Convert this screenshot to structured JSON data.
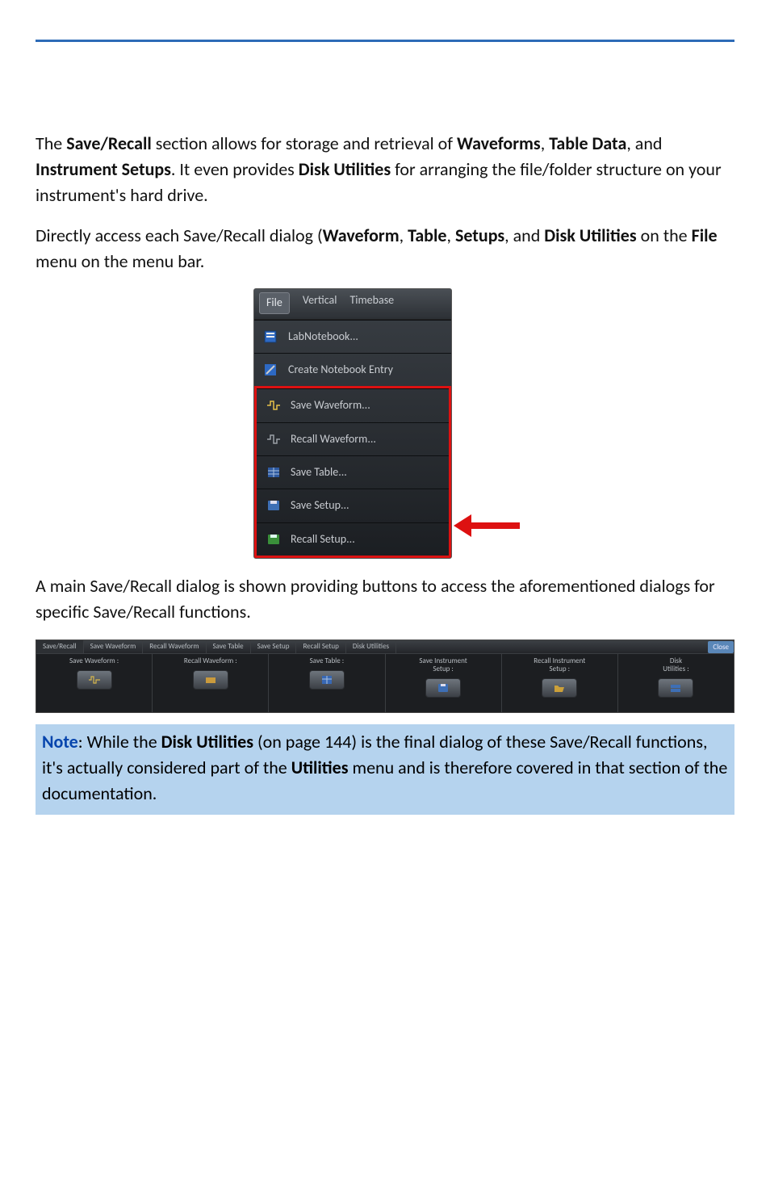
{
  "para1": {
    "t1": "The ",
    "b1": "Save/Recall",
    "t2": " section allows for storage and retrieval of ",
    "b2": "Waveforms",
    "t3": ", ",
    "b3": "Table Data",
    "t4": ", and ",
    "b4": "Instrument Setups",
    "t5": ". It even provides ",
    "b5": "Disk Utilities",
    "t6": " for arranging the file/folder structure on your instrument's hard drive."
  },
  "para2": {
    "t1": "Directly access each Save/Recall dialog (",
    "b1": "Waveform",
    "t2": ", ",
    "b2": "Table",
    "t3": ", ",
    "b3": "Setups",
    "t4": ", and ",
    "b4": "Disk Utilities",
    "t5": " on the ",
    "b5": "File",
    "t6": " menu on the menu bar."
  },
  "menu": {
    "menubar": {
      "file": "File",
      "vertical": "Vertical",
      "timebase": "Timebase"
    },
    "items": {
      "labnotebook": "LabNotebook...",
      "create_entry": "Create Notebook Entry",
      "save_waveform": "Save Waveform...",
      "recall_waveform": "Recall Waveform...",
      "save_table": "Save Table...",
      "save_setup": "Save Setup...",
      "recall_setup": "Recall Setup..."
    }
  },
  "para3": "A main Save/Recall dialog is shown providing buttons to access the aforementioned dialogs for specific Save/Recall functions.",
  "dialog": {
    "tabs": {
      "t0": "Save/Recall",
      "t1": "Save Waveform",
      "t2": "Recall Waveform",
      "t3": "Save Table",
      "t4": "Save Setup",
      "t5": "Recall Setup",
      "t6": "Disk Utilities"
    },
    "close": "Close",
    "groups": {
      "g0": "Save Waveform :",
      "g1": "Recall Waveform :",
      "g2": "Save Table :",
      "g3": "Save Instrument\nSetup :",
      "g4": "Recall Instrument\nSetup :",
      "g5": "Disk\nUtilities :"
    }
  },
  "note": {
    "lead": "Note",
    "t1": ": While the ",
    "b1": "Disk Utilities",
    "t2": " (on page 144) is the final dialog of these Save/Recall functions, it's actually considered part of the ",
    "b2": "Utilities",
    "t3": " menu and is therefore covered in that section of the documentation."
  }
}
